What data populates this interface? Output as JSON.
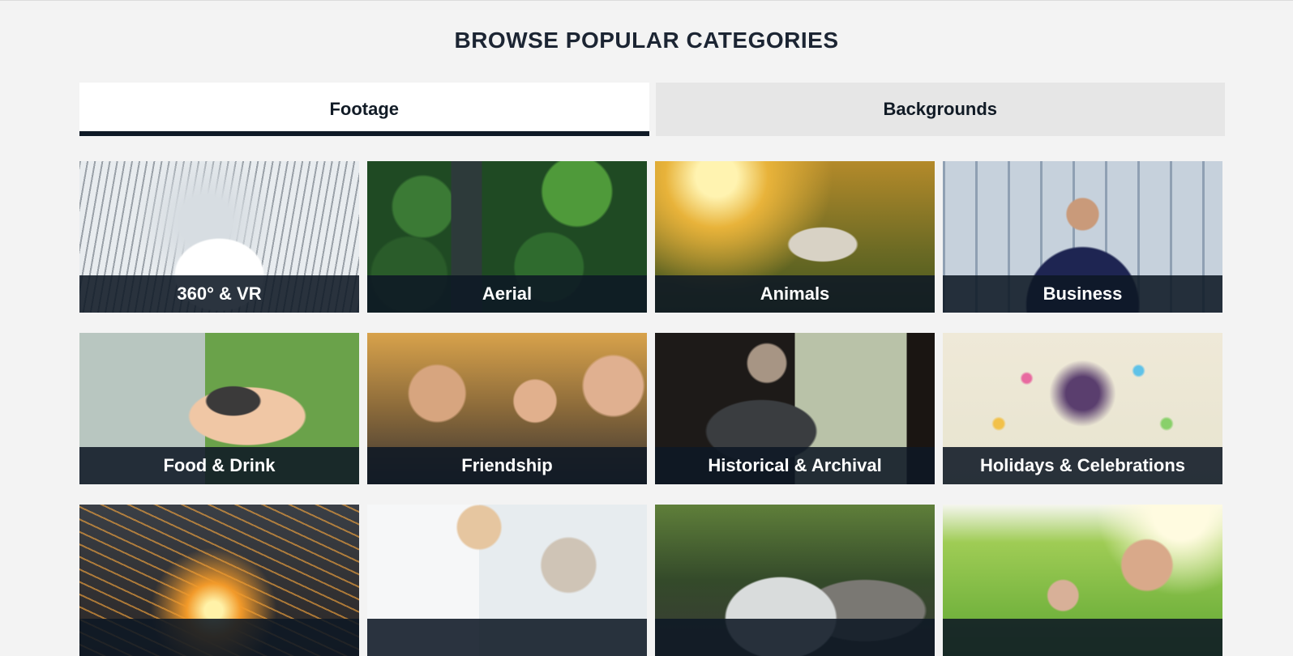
{
  "heading": "BROWSE POPULAR CATEGORIES",
  "tabs": [
    {
      "label": "Footage",
      "active": true
    },
    {
      "label": "Backgrounds",
      "active": false
    }
  ],
  "categories": [
    {
      "label": "360° & VR"
    },
    {
      "label": "Aerial"
    },
    {
      "label": "Animals"
    },
    {
      "label": "Business"
    },
    {
      "label": "Food & Drink"
    },
    {
      "label": "Friendship"
    },
    {
      "label": "Historical & Archival"
    },
    {
      "label": "Holidays & Celebrations"
    },
    {
      "label": ""
    },
    {
      "label": ""
    },
    {
      "label": ""
    },
    {
      "label": ""
    }
  ]
}
